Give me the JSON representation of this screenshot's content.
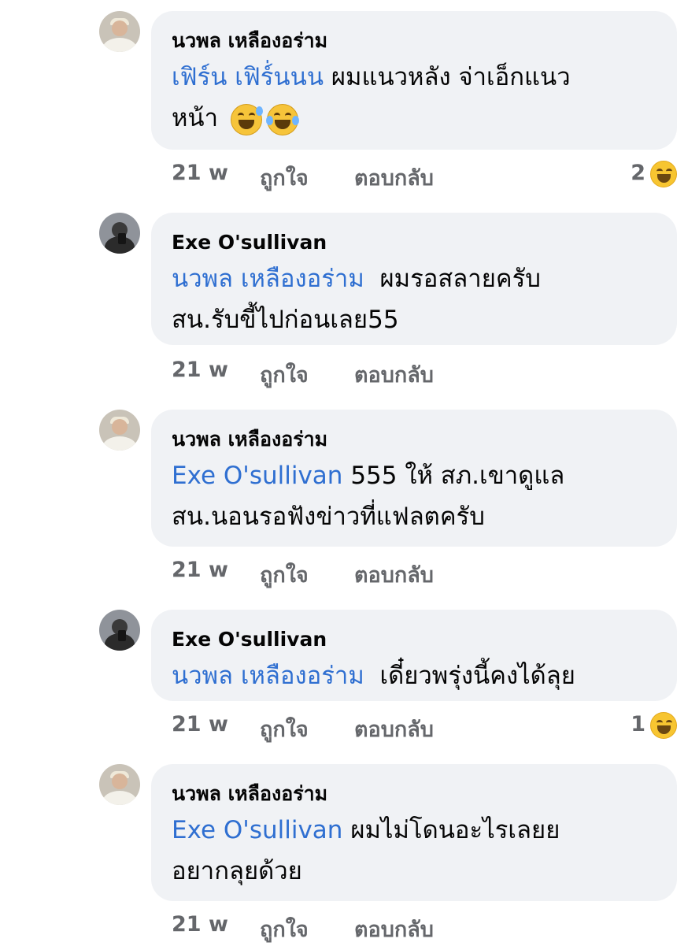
{
  "comments": [
    {
      "author": "นวพล เหลืองอร่าม",
      "mention": "เฟิร์น เฟิร์่นนน",
      "text": "ผมแนวหลัง จ่าเอ็กแนว",
      "text_line2": "หน้า",
      "emojis": [
        "grinning-sweat-emoji",
        "tears-of-joy-emoji"
      ],
      "time": "21 w",
      "like": "ถูกใจ",
      "reply": "ตอบกลับ",
      "reaction_count": "2",
      "reaction_icon": "haha-reaction-icon"
    },
    {
      "author": "Exe O'sullivan",
      "mention": "นวพล เหลืองอร่าม",
      "text": "ผมรอสลายครับ",
      "text_line2": "สน.รับขี้ไปก่อนเลย55",
      "time": "21 w",
      "like": "ถูกใจ",
      "reply": "ตอบกลับ"
    },
    {
      "author": "นวพล เหลืองอร่าม",
      "mention": "Exe O'sullivan",
      "text": "555 ให้ สภ.เขาดูแล",
      "text_line2": "สน.นอนรอฟังข่าวที่แฟลตครับ",
      "time": "21 w",
      "like": "ถูกใจ",
      "reply": "ตอบกลับ"
    },
    {
      "author": "Exe O'sullivan",
      "mention": "นวพล เหลืองอร่าม",
      "text": "เดี๋ยวพรุ่งนี้คงได้ลุย",
      "time": "21 w",
      "like": "ถูกใจ",
      "reply": "ตอบกลับ",
      "reaction_count": "1",
      "reaction_icon": "haha-reaction-icon"
    },
    {
      "author": "นวพล เหลืองอร่าม",
      "mention": "Exe O'sullivan",
      "text": "ผมไม่โดนอะไรเลยย",
      "text_line2": "อยากลุยด้วย",
      "time": "21 w",
      "like": "ถูกใจ",
      "reply": "ตอบกลับ"
    }
  ],
  "colors": {
    "bubble": "#f0f2f5",
    "mention": "#2f6fd1",
    "meta": "#65676b",
    "haha": "#f7c531"
  }
}
